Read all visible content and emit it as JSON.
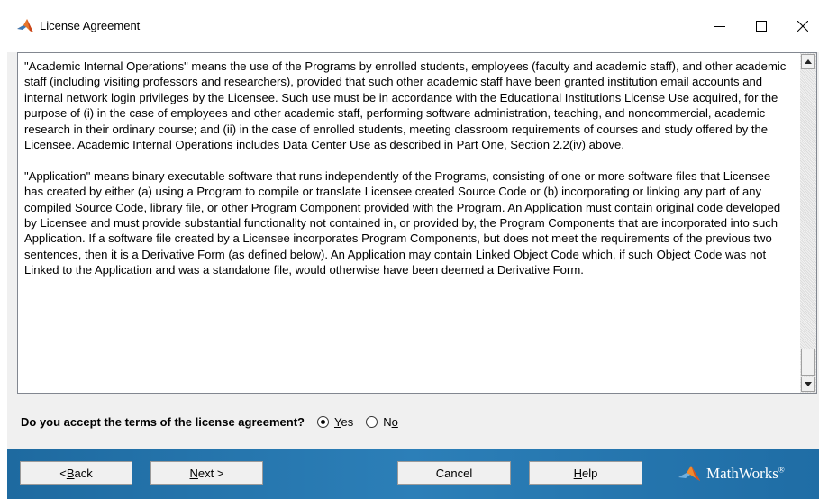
{
  "window": {
    "title": "License Agreement"
  },
  "license": {
    "paragraphs": [
      "\"Academic Internal Operations\" means the use of the Programs by enrolled students, employees (faculty and academic staff), and other academic staff (including visiting professors and researchers), provided that such other academic staff have been granted institution email accounts and internal network login privileges by the Licensee. Such use must be in accordance with the Educational Institutions License Use acquired, for the purpose of (i) in the case of employees and other academic staff, performing software administration, teaching, and noncommercial, academic research in their ordinary course; and (ii) in the case of enrolled students, meeting classroom requirements of courses and study offered by the Licensee. Academic Internal Operations includes Data Center Use as described in Part One, Section 2.2(iv) above.",
      "\"Application\" means binary executable software that runs independently of the Programs, consisting of one or more software files that Licensee has created by either (a) using a Program to compile or translate Licensee created Source Code or (b) incorporating or linking any part of any compiled Source Code, library file, or other Program Component provided with the Program. An Application must contain original code developed by Licensee and must provide substantial functionality not contained in, or provided by, the Program Components that are incorporated into such Application. If a software file created by a Licensee incorporates Program Components, but does not meet the requirements of the previous two sentences, then it is a Derivative Form (as defined below). An Application may contain Linked Object Code which, if such Object Code was not Linked to the Application and was a standalone file, would otherwise have been deemed a Derivative Form."
    ]
  },
  "accept": {
    "question": "Do you accept the terms of the license agreement?",
    "yes_prefix": "",
    "yes_mnemonic": "Y",
    "yes_rest": "es",
    "no_prefix": "N",
    "no_mnemonic": "o",
    "no_rest": "",
    "selected": "Yes"
  },
  "buttons": {
    "back_prefix": "< ",
    "back_mnemonic": "B",
    "back_rest": "ack",
    "next_prefix": "",
    "next_mnemonic": "N",
    "next_rest": "ext >",
    "cancel": "Cancel",
    "help_prefix": "",
    "help_mnemonic": "H",
    "help_rest": "elp"
  },
  "brand": {
    "name": "MathWorks",
    "mark": "®"
  },
  "icons": {
    "app": "matlab-membrane-icon",
    "minimize": "minimize-icon",
    "maximize": "maximize-icon",
    "close": "close-icon",
    "logo": "mathworks-logo-icon"
  },
  "colors": {
    "footer": "#1e6aa0",
    "window_bg": "#f0f0f0",
    "brand_text": "#ffffff"
  }
}
